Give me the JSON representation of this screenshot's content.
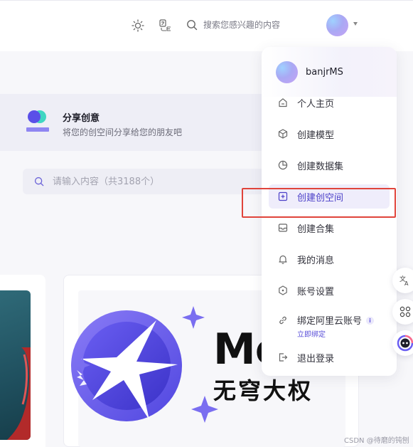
{
  "header": {
    "search_placeholder": "搜索您感兴趣的内容",
    "icons": [
      "theme-sun-icon",
      "language-switch-icon",
      "search-icon",
      "avatar",
      "caret-down-icon"
    ]
  },
  "share_banner": {
    "title": "分享创意",
    "subtitle": "将您的创空间分享给您的朋友吧"
  },
  "page_search": {
    "placeholder": "请输入内容（共3188个）"
  },
  "featured_card": {
    "brand_latin": "Me",
    "brand_cn": "无穹大权"
  },
  "user_menu": {
    "username": "banjrMS",
    "items": [
      {
        "label": "个人主页",
        "icon": "home-icon"
      },
      {
        "label": "创建模型",
        "icon": "cube-icon"
      },
      {
        "label": "创建数据集",
        "icon": "pie-chart-icon"
      },
      {
        "label": "创建创空间",
        "icon": "folder-plus-icon",
        "active": true
      },
      {
        "label": "创建合集",
        "icon": "inbox-icon"
      },
      {
        "label": "我的消息",
        "icon": "bell-icon"
      },
      {
        "label": "账号设置",
        "icon": "settings-icon"
      }
    ],
    "aliyun": {
      "label": "绑定阿里云账号",
      "info": "i",
      "link": "立即绑定"
    },
    "logout": "退出登录"
  },
  "floating_buttons": [
    "translate-icon",
    "apps-grid-icon",
    "assistant-icon"
  ],
  "colors": {
    "accent": "#5a4fd8",
    "highlight_border": "#e0443b",
    "active_bg": "#efedfb"
  },
  "watermark": "CSDN @待磨的钝刨"
}
